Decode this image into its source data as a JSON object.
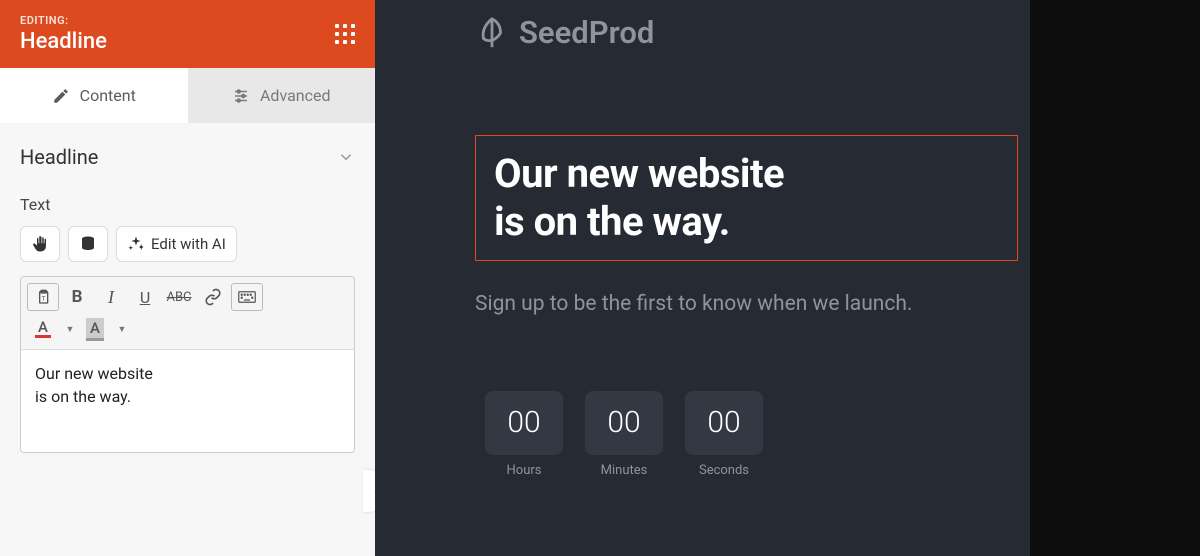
{
  "editor": {
    "editing_label": "EDITING:",
    "editing_title": "Headline",
    "tabs": {
      "content": "Content",
      "advanced": "Advanced"
    },
    "section_title": "Headline",
    "text_label": "Text",
    "ai_button": "Edit with AI",
    "toolbar_letters": {
      "bold": "B",
      "italic": "I",
      "underline": "U",
      "strike": "ABC",
      "text_color": "A",
      "bg_color": "A"
    },
    "text_value": "Our new website\nis on the way."
  },
  "preview": {
    "brand": "SeedProd",
    "headline": "Our new website\nis on the way.",
    "subtext": "Sign up to be the first to know when we launch.",
    "countdown": [
      {
        "value": "00",
        "label": "Hours"
      },
      {
        "value": "00",
        "label": "Minutes"
      },
      {
        "value": "00",
        "label": "Seconds"
      }
    ]
  }
}
